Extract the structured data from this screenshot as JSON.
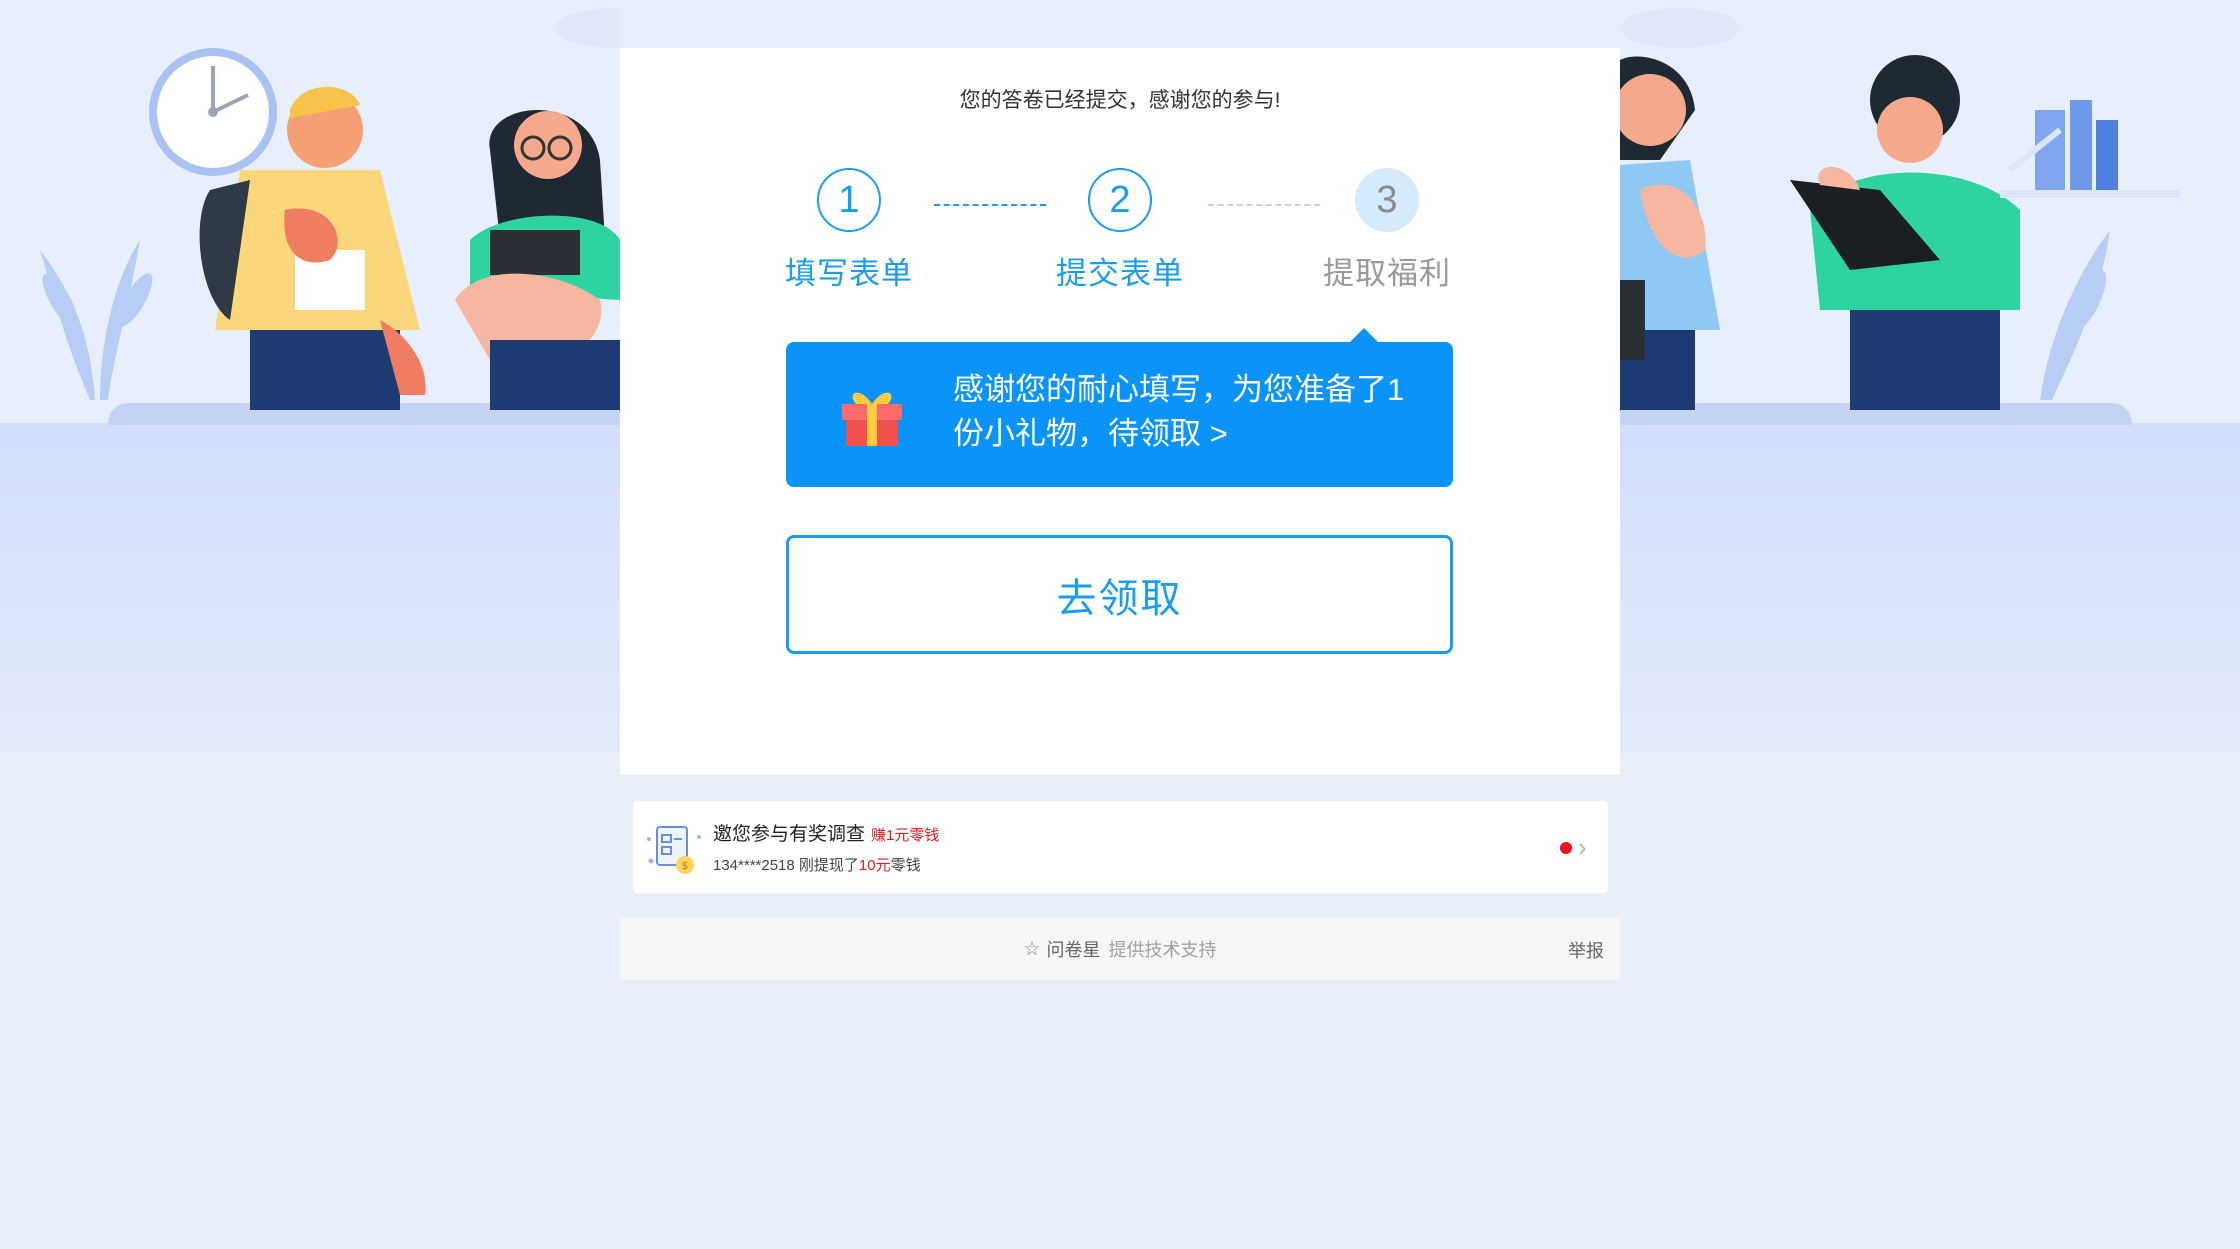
{
  "card": {
    "submitted_message": "您的答卷已经提交，感谢您的参与!"
  },
  "steps": [
    {
      "number": "1",
      "label": "填写表单",
      "state": "done"
    },
    {
      "number": "2",
      "label": "提交表单",
      "state": "done"
    },
    {
      "number": "3",
      "label": "提取福利",
      "state": "current"
    }
  ],
  "gift": {
    "text": "感谢您的耐心填写，为您准备了1份小礼物，待领取 >",
    "icon": "gift-icon"
  },
  "claim_button": {
    "label": "去领取"
  },
  "promo": {
    "title": "邀您参与有奖调查",
    "earn_badge": "赚1元零钱",
    "sub_prefix": "134****2518 刚提现了",
    "sub_amount": "10元",
    "sub_suffix": "零钱",
    "icon": "survey-document-icon"
  },
  "footer": {
    "brand": "问卷星",
    "support": "提供技术支持",
    "report": "举报"
  },
  "colors": {
    "accent": "#1a9cf1",
    "banner": "#0a93f9",
    "highlight_red": "#e01b1b",
    "background": "#e9eefb"
  }
}
